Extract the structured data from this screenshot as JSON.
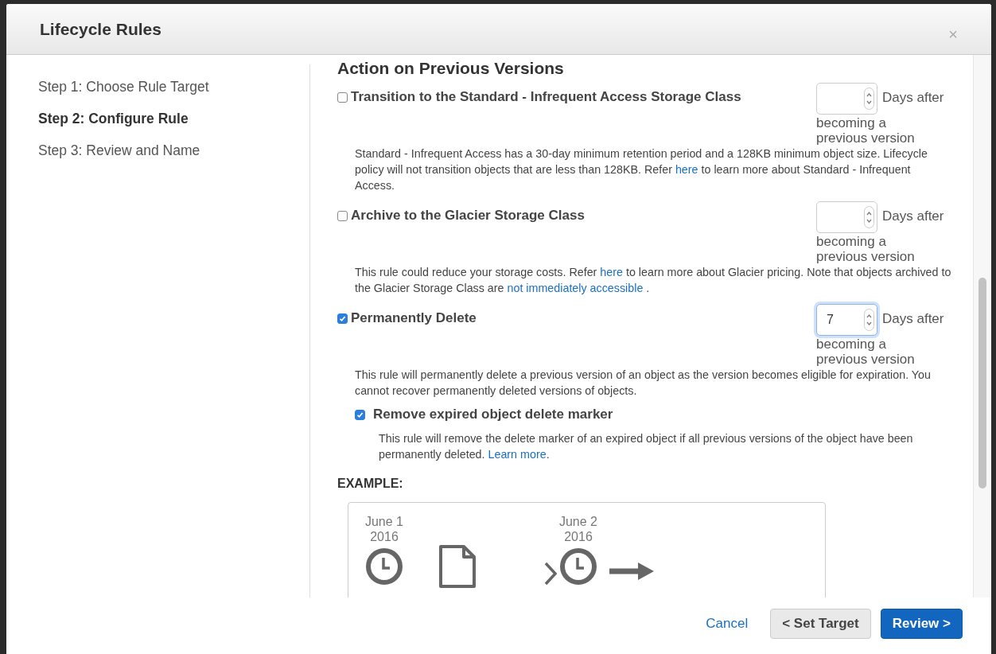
{
  "window": {
    "title": "Lifecycle Rules",
    "close": "×"
  },
  "steps": [
    {
      "label": "Step 1: Choose Rule Target",
      "selected": false
    },
    {
      "label": "Step 2: Configure Rule",
      "selected": true
    },
    {
      "label": "Step 3: Review and Name",
      "selected": false
    }
  ],
  "section_title": "Action on Previous Versions",
  "actions": [
    {
      "label": "Transition to the Standard - Infrequent Access Storage Class",
      "checked": false,
      "days": {
        "focused": false,
        "suffix": "Days after",
        "note": "becoming a previous version"
      },
      "description": [
        {
          "kind": "text",
          "text": "Standard - Infrequent Access has a 30-day minimum retention period and a 128KB minimum object size. Lifecycle policy will not transition objects that are less than 128KB. Refer "
        },
        {
          "kind": "link",
          "text": "here"
        },
        {
          "kind": "text",
          "text": " to learn more about Standard - Infrequent Access."
        }
      ]
    },
    {
      "label": "Archive to the Glacier Storage Class",
      "checked": false,
      "days": {
        "focused": false,
        "suffix": "Days after",
        "note": "becoming a previous version"
      },
      "description": [
        {
          "kind": "text",
          "text": "This rule could reduce your storage costs. Refer "
        },
        {
          "kind": "link",
          "text": "here"
        },
        {
          "kind": "text",
          "text": " to learn more about Glacier pricing. Note that objects archived to the Glacier Storage Class are "
        },
        {
          "kind": "link",
          "text": "not immediately accessible"
        },
        {
          "kind": "text",
          "text": " ."
        }
      ]
    },
    {
      "label": "Permanently Delete",
      "checked": true,
      "days": {
        "value": "7",
        "focused": true,
        "suffix": "Days after",
        "note": "becoming a previous version"
      },
      "description": [
        {
          "kind": "text",
          "text": "This rule will permanently delete a previous version of an object as the version becomes eligible for expiration. You cannot recover permanently deleted versions of objects."
        }
      ],
      "children": [
        {
          "label": "Remove expired object delete marker",
          "checked": true,
          "description": [
            {
              "kind": "text",
              "text": "This rule will remove the delete marker of an expired object if all previous versions of the object have been permanently deleted. "
            },
            {
              "kind": "link",
              "text": "Learn more"
            },
            {
              "kind": "text",
              "text": "."
            }
          ]
        }
      ]
    }
  ],
  "example": {
    "heading": "EXAMPLE:",
    "items": [
      {
        "kind": "clock",
        "date": "June 1",
        "year": "2016"
      },
      {
        "kind": "file"
      },
      {
        "kind": "chevron"
      },
      {
        "kind": "clock",
        "date": "June 2",
        "year": "2016"
      },
      {
        "kind": "arrow"
      }
    ]
  },
  "footer": {
    "cancel": "Cancel",
    "back": "< Set Target",
    "next": "Review >"
  }
}
